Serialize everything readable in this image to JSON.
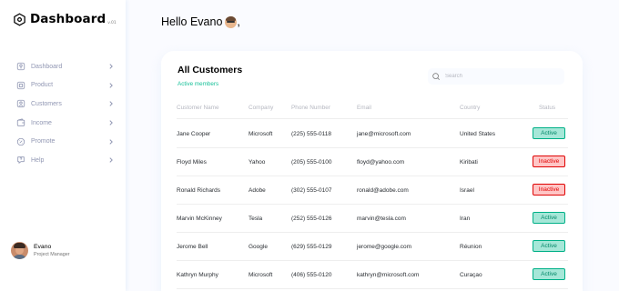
{
  "brand": {
    "name": "Dashboard",
    "version": "v.01"
  },
  "nav": [
    {
      "label": "Dashboard",
      "icon": "key-icon"
    },
    {
      "label": "Product",
      "icon": "cube-icon"
    },
    {
      "label": "Customers",
      "icon": "user-square-icon"
    },
    {
      "label": "Income",
      "icon": "wallet-icon"
    },
    {
      "label": "Promote",
      "icon": "discount-icon"
    },
    {
      "label": "Help",
      "icon": "message-question-icon"
    }
  ],
  "profile": {
    "name": "Evano",
    "role": "Project Manager"
  },
  "greeting": {
    "text": "Hello Evano",
    "suffix": ","
  },
  "customers": {
    "title": "All Customers",
    "subtitle": "Active members",
    "search_placeholder": "Search",
    "columns": [
      "Customer Name",
      "Company",
      "Phone Number",
      "Email",
      "Country",
      "Status"
    ],
    "rows": [
      {
        "name": "Jane Cooper",
        "company": "Microsoft",
        "phone": "(225) 555-0118",
        "email": "jane@microsoft.com",
        "country": "United States",
        "status": "Active"
      },
      {
        "name": "Floyd Miles",
        "company": "Yahoo",
        "phone": "(205) 555-0100",
        "email": "floyd@yahoo.com",
        "country": "Kiribati",
        "status": "Inactive"
      },
      {
        "name": "Ronald Richards",
        "company": "Adobe",
        "phone": "(302) 555-0107",
        "email": "ronald@adobe.com",
        "country": "Israel",
        "status": "Inactive"
      },
      {
        "name": "Marvin McKinney",
        "company": "Tesla",
        "phone": "(252) 555-0126",
        "email": "marvin@tesla.com",
        "country": "Iran",
        "status": "Active"
      },
      {
        "name": "Jerome Bell",
        "company": "Google",
        "phone": "(629) 555-0129",
        "email": "jerome@google.com",
        "country": "Réunion",
        "status": "Active"
      },
      {
        "name": "Kathryn Murphy",
        "company": "Microsoft",
        "phone": "(406) 555-0120",
        "email": "kathryn@microsoft.com",
        "country": "Curaçao",
        "status": "Active"
      }
    ]
  },
  "colors": {
    "accent_green": "#16c098",
    "active_bg": "#a6e7d8",
    "inactive_bg": "#ffc5c5",
    "muted": "#9197b3"
  }
}
